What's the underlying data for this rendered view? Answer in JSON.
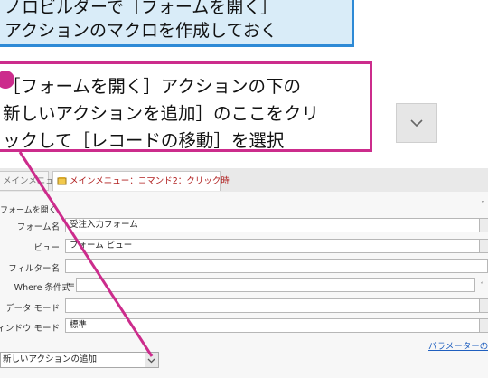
{
  "callout_top": {
    "line1": "ノロビルダーで［フォームを開く］",
    "line2": "アクションのマクロを作成しておく"
  },
  "callout_step": {
    "line1": "［フォームを開く］アクションの下の",
    "line2": "新しいアクションを追加］のここをクリ",
    "line3": "ックして［レコードの移動］を選択"
  },
  "tabs": {
    "main_menu": "メインメニュー",
    "macro_tab": "メインメニュー：コマンド2：クリック時"
  },
  "action": {
    "title": "フォームを開く",
    "fields": [
      {
        "label": "フォーム名",
        "value": "受注入力フォーム"
      },
      {
        "label": "ビュー",
        "value": "フォーム ビュー"
      },
      {
        "label": "フィルター名",
        "value": ""
      },
      {
        "label": "Where 条件式",
        "prefix": "=",
        "value": ""
      },
      {
        "label": "データ モード",
        "value": ""
      },
      {
        "label": "ウィンドウ モード",
        "value": "標準"
      }
    ],
    "params_link": "パラメーターの更新"
  },
  "new_action": {
    "value": "新しいアクションの追加"
  },
  "colors": {
    "callout_blue_border": "#2e8ad6",
    "callout_blue_fill": "#d9ecf8",
    "step_pink": "#cc2c8c",
    "tab_text_red": "#b01e1e",
    "link_blue": "#1f5fbf"
  }
}
